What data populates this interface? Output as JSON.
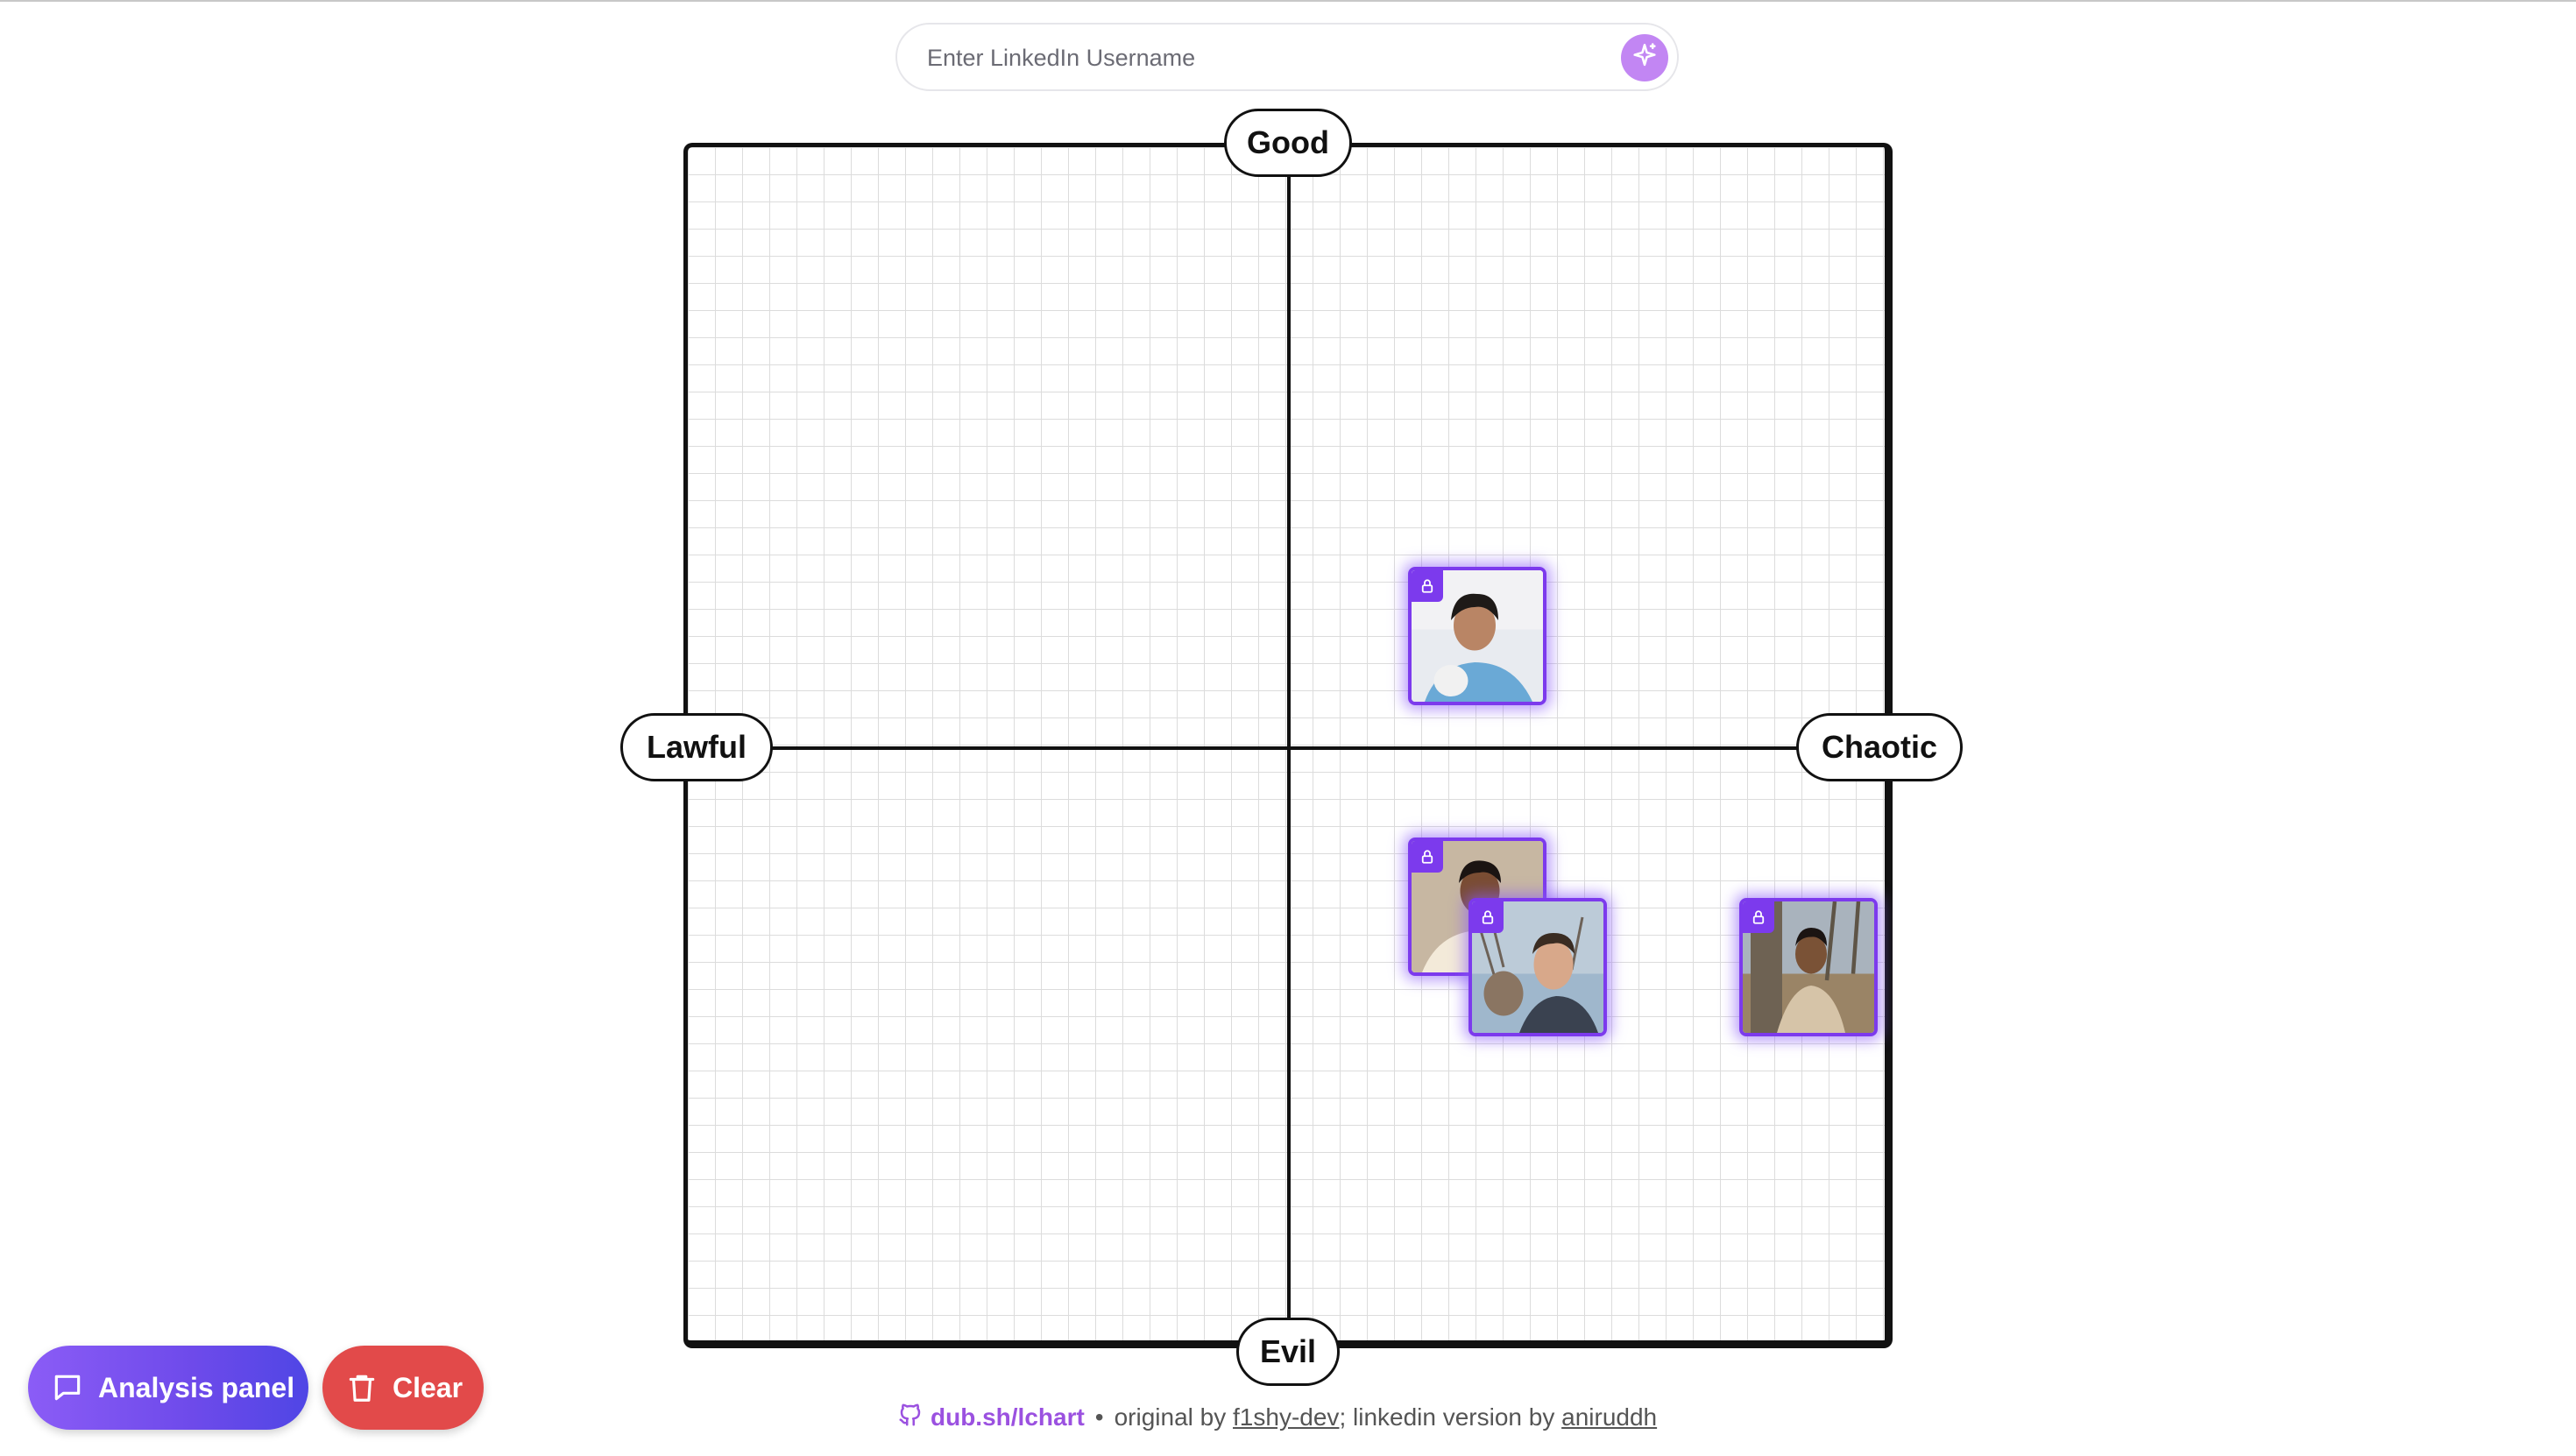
{
  "search": {
    "placeholder": "Enter LinkedIn Username",
    "value": "",
    "button_icon": "sparkle-icon"
  },
  "chart": {
    "axes": {
      "top": "Good",
      "bottom": "Evil",
      "left": "Lawful",
      "right": "Chaotic"
    },
    "grid": true,
    "profiles": [
      {
        "id": "profile-1",
        "locked": true,
        "quadrant": "chaotic-good"
      },
      {
        "id": "profile-2",
        "locked": true,
        "quadrant": "chaotic-evil"
      },
      {
        "id": "profile-3",
        "locked": true,
        "quadrant": "chaotic-evil"
      },
      {
        "id": "profile-4",
        "locked": true,
        "quadrant": "chaotic-evil"
      }
    ],
    "accent_color": "#7c3aed"
  },
  "buttons": {
    "analysis_label": "Analysis panel",
    "analysis_icon": "message-square-icon",
    "clear_label": "Clear",
    "clear_icon": "trash-icon",
    "clear_color": "#e24a4a"
  },
  "footer": {
    "repo_link": "dub.sh/lchart",
    "repo_icon": "github-icon",
    "separator": "•",
    "original_prefix": "original by",
    "original_author": "f1shy-dev",
    "version_prefix": "; linkedin version by",
    "version_author": "aniruddh"
  }
}
